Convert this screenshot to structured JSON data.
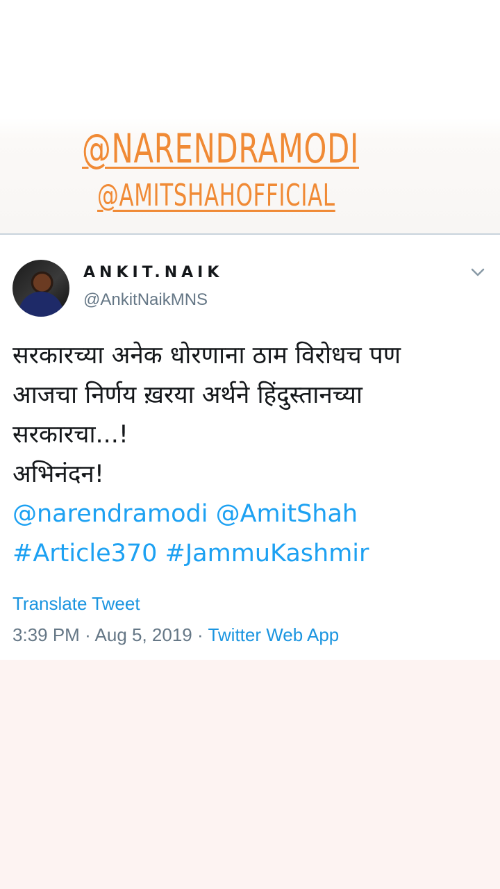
{
  "overlay": {
    "mention_1": "@NARENDRAMODI",
    "mention_2": "@AMITSHAHOFFICIAL",
    "color": "#f08a35"
  },
  "tweet": {
    "author_name": "ANKIT.NAIK",
    "author_handle": "@AnkitNaikMNS",
    "menu_icon": "chevron-down-icon",
    "text_lines": [
      "सरकारच्या अनेक धोरणाना ठाम विरोधच पण",
      "आजचा निर्णय ख़रया अर्थने हिंदुस्तानच्या",
      "सरकारचा...!",
      "अभिनंदन!"
    ],
    "mentions_line": "@narendramodi @AmitShah",
    "hashtags_line": "#Article370 #JammuKashmir",
    "translate_label": "Translate Tweet",
    "time": "3:39 PM",
    "date": "Aug 5, 2019",
    "separator": "·",
    "source_app": "Twitter Web App",
    "link_color": "#1da1f2"
  }
}
